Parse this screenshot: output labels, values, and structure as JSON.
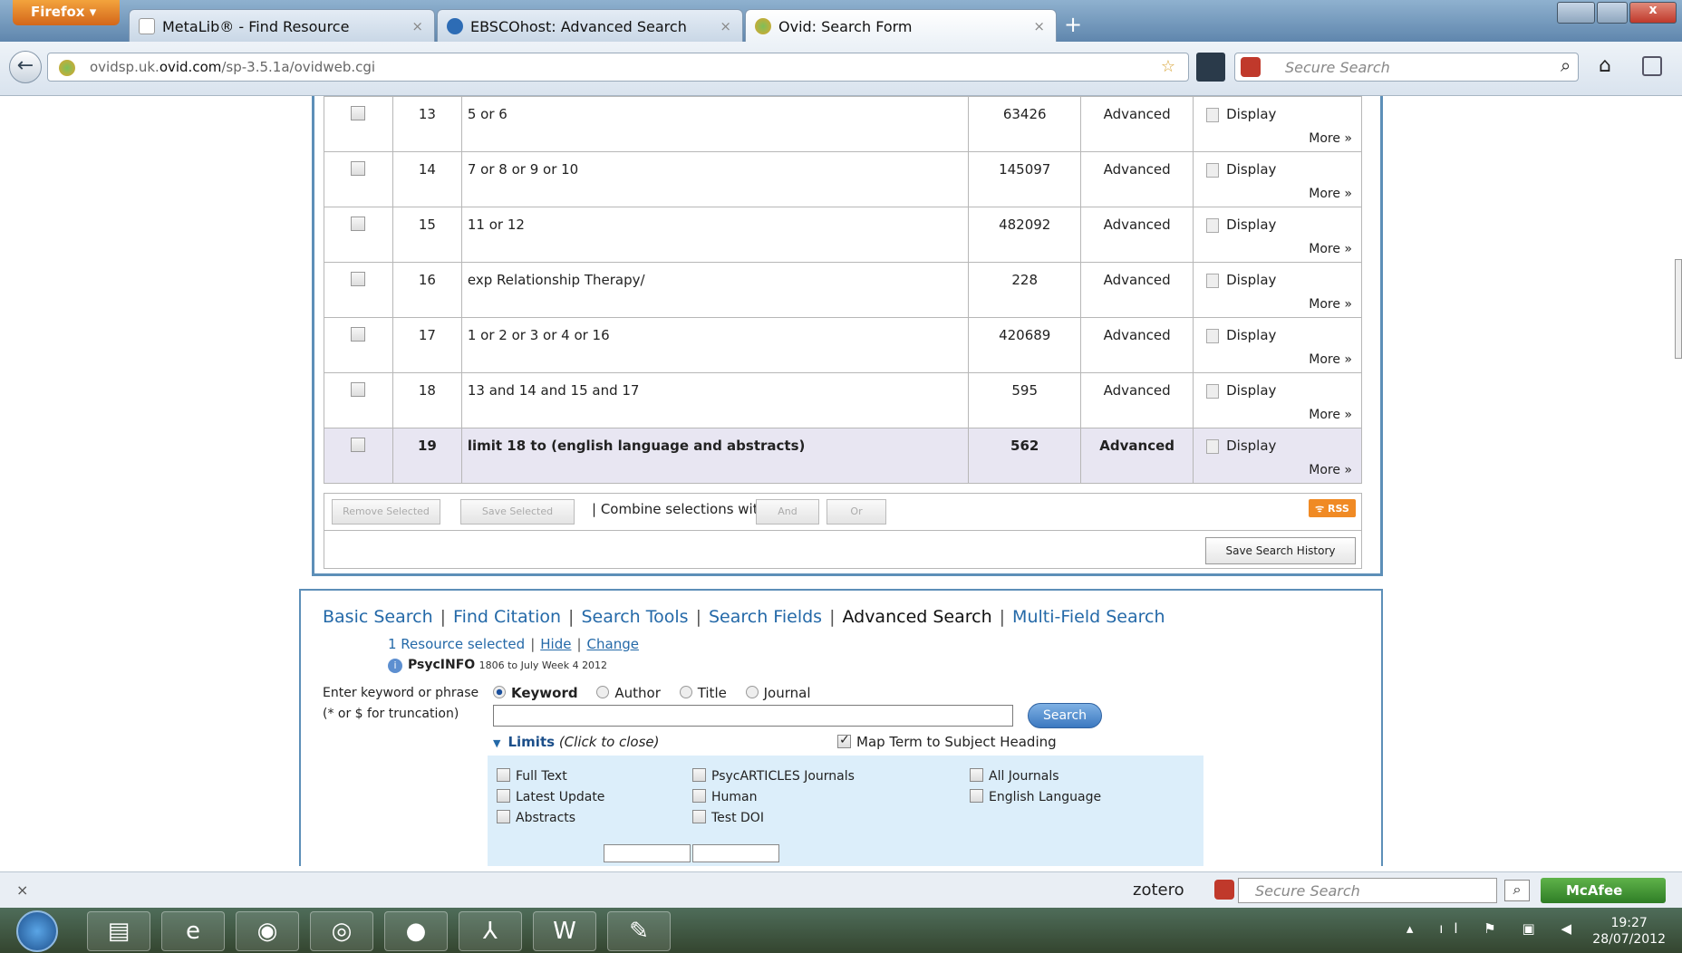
{
  "browser": {
    "menu_button": "Firefox ▾",
    "tabs": [
      {
        "title": "MetaLib® - Find Resource"
      },
      {
        "title": "EBSCOhost: Advanced Search"
      },
      {
        "title": "Ovid: Search Form"
      }
    ],
    "url_prefix": "ovidsp.uk.",
    "url_domain": "ovid.com",
    "url_path": "/sp-3.5.1a/ovidweb.cgi",
    "search_placeholder": "Secure Search"
  },
  "history": {
    "rows": [
      {
        "num": "13",
        "query": "5 or 6",
        "results": "63426",
        "type": "Advanced"
      },
      {
        "num": "14",
        "query": "7 or 8 or 9 or 10",
        "results": "145097",
        "type": "Advanced"
      },
      {
        "num": "15",
        "query": "11 or 12",
        "results": "482092",
        "type": "Advanced"
      },
      {
        "num": "16",
        "query": "exp Relationship Therapy/",
        "results": "228",
        "type": "Advanced"
      },
      {
        "num": "17",
        "query": "1 or 2 or 3 or 4 or 16",
        "results": "420689",
        "type": "Advanced"
      },
      {
        "num": "18",
        "query": "13 and 14 and 15 and 17",
        "results": "595",
        "type": "Advanced"
      },
      {
        "num": "19",
        "query": "limit 18 to (english language and abstracts)",
        "results": "562",
        "type": "Advanced"
      }
    ],
    "display_label": "Display",
    "more_label": "More »",
    "remove_selected": "Remove Selected",
    "save_selected": "Save Selected",
    "combine_label": "| Combine selections with:",
    "and_label": "And",
    "or_label": "Or",
    "rss_label": "RSS",
    "save_history": "Save Search History"
  },
  "search_form": {
    "tabs": [
      "Basic Search",
      "Find Citation",
      "Search Tools",
      "Search Fields",
      "Advanced Search",
      "Multi-Field Search"
    ],
    "active_tab": "Advanced Search",
    "resource_selected": "1 Resource selected",
    "hide": "Hide",
    "change": "Change",
    "database": "PsycINFO",
    "database_range": "1806 to July Week 4 2012",
    "keyword_label_line1": "Enter keyword or phrase",
    "keyword_label_line2": "(* or $ for truncation)",
    "radio_options": [
      "Keyword",
      "Author",
      "Title",
      "Journal"
    ],
    "selected_radio": "Keyword",
    "search_value": "",
    "search_button": "Search",
    "limits_label": "Limits",
    "limits_hint": "(Click to close)",
    "map_term": "Map Term to Subject Heading",
    "map_term_checked": true,
    "limits": [
      "Full Text",
      "Latest Update",
      "Abstracts",
      "PsycARTICLES Journals",
      "Human",
      "Test DOI",
      "All Journals",
      "English Language"
    ]
  },
  "statusbar": {
    "close": "×",
    "zotero": "zotero",
    "search_placeholder": "Secure Search",
    "mcafee": "McAfee"
  },
  "taskbar": {
    "time": "19:27",
    "date": "28/07/2012"
  }
}
